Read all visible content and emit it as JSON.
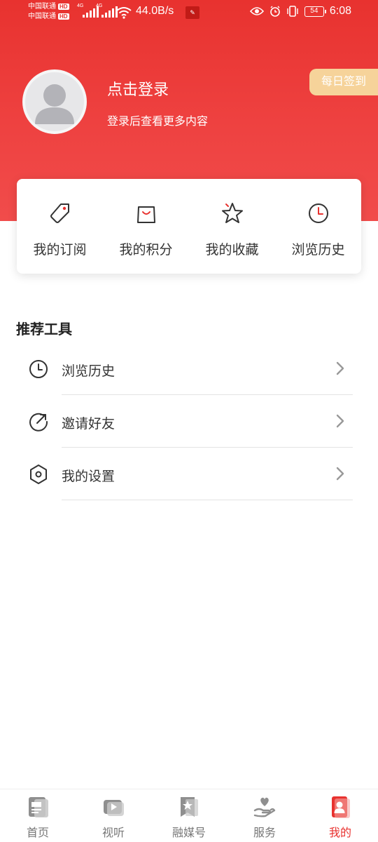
{
  "status_bar": {
    "carrier_1": "中国联通",
    "carrier_2": "中国联通",
    "hd_badge": "HD",
    "network_1": "4G",
    "network_2": "4G",
    "net_speed": "44.0B/s",
    "battery": "54",
    "time": "6:08"
  },
  "profile": {
    "login_title": "点击登录",
    "login_subtitle": "登录后查看更多内容",
    "checkin_label": "每日签到"
  },
  "quick_actions": [
    {
      "label": "我的订阅",
      "icon": "tag-icon"
    },
    {
      "label": "我的积分",
      "icon": "shopping-bag-icon"
    },
    {
      "label": "我的收藏",
      "icon": "star-icon"
    },
    {
      "label": "浏览历史",
      "icon": "clock-icon"
    }
  ],
  "tools": {
    "title": "推荐工具",
    "items": [
      {
        "label": "浏览历史",
        "icon": "clock-icon"
      },
      {
        "label": "邀请好友",
        "icon": "share-arrow-icon"
      },
      {
        "label": "我的设置",
        "icon": "settings-hexagon-icon"
      }
    ]
  },
  "bottom_nav": {
    "items": [
      {
        "label": "首页",
        "icon": "news-icon",
        "active": false
      },
      {
        "label": "视听",
        "icon": "play-icon",
        "active": false
      },
      {
        "label": "融媒号",
        "icon": "bookmark-star-icon",
        "active": false
      },
      {
        "label": "服务",
        "icon": "hand-heart-icon",
        "active": false
      },
      {
        "label": "我的",
        "icon": "profile-card-icon",
        "active": true
      }
    ]
  },
  "colors": {
    "header_red": "#e8322f",
    "checkin_gold": "#f6d39a",
    "active_nav": "#e8322f",
    "inactive_nav": "#777777"
  }
}
